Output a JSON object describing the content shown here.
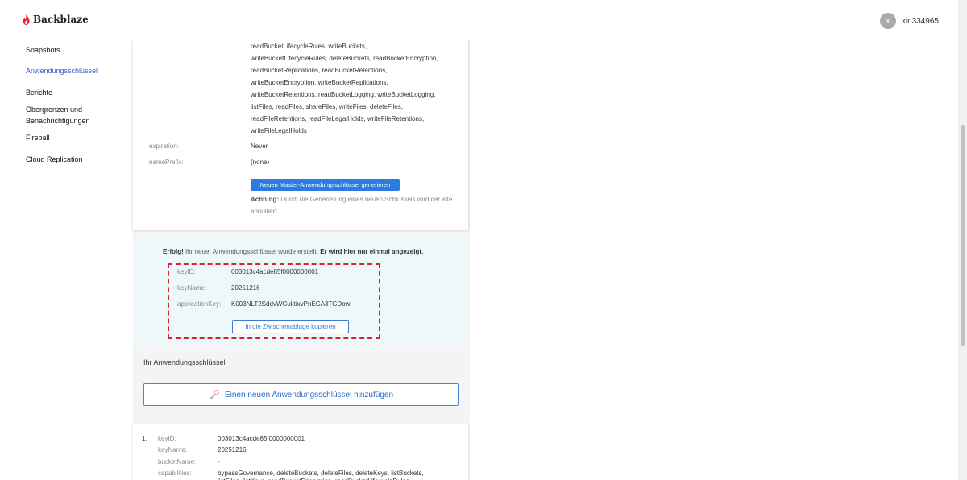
{
  "header": {
    "logo_text": "Backblaze",
    "avatar_initial": "x",
    "username": "xin334965"
  },
  "sidebar": {
    "items": [
      {
        "label": "Snapshots"
      },
      {
        "label": "Anwendungsschlüssel",
        "active": true
      },
      {
        "label": "Berichte"
      },
      {
        "label": "Obergrenzen und"
      },
      {
        "label": "Benachrichtigungen"
      },
      {
        "label": "Fireball"
      },
      {
        "label": "Cloud Replication"
      }
    ]
  },
  "master_key": {
    "capability_lines": [
      "readBucketLifecycleRules, writeBuckets,",
      "writeBucketLifecycleRules, deleteBuckets, readBucketEncryption,",
      "readBucketReplications, readBucketRetentions,",
      "writeBucketEncryption, writeBucketReplications,",
      "writeBucketRetentions, readBucketLogging, writeBucketLogging,",
      "listFiles, readFiles, shareFiles, writeFiles, deleteFiles,",
      "readFileRetentions, readFileLegalHolds, writeFileRetentions,",
      "writeFileLegalHolds"
    ],
    "expiration_label": "expiration:",
    "expiration_value": "Never",
    "nameprefix_label": "namePrefix:",
    "nameprefix_value": "(none)",
    "generate_button": "Neuen Master-Anwendungsschlüssel generieren",
    "warning_bold": "Achtung:",
    "warning_text": " Durch die Generierung eines neuen Schlüssels wird der alte annulliert."
  },
  "success": {
    "prefix_bold": "Erfolg!",
    "message": " Ihr neuer Anwendungsschlüssel wurde erstellt. ",
    "suffix_bold": "Er wird hier nur einmal angezeigt.",
    "keyid_label": "keyID:",
    "keyid_value": "003013c4acde85f0000000001",
    "keyname_label": "keyName:",
    "keyname_value": "20251216",
    "appkey_label": "applicationKey:",
    "appkey_value": "K003NLT2SddvWCuktixvPnECA3TGDow",
    "copy_button": "In die Zwischenablage kopieren"
  },
  "keys_section": {
    "title": "Ihr Anwendungsschlüssel",
    "add_button": "Einen neuen Anwendungsschlüssel hinzufügen"
  },
  "key_list": [
    {
      "index": "1.",
      "keyid_label": "keyID:",
      "keyid_value": "003013c4acde85f0000000001",
      "keyname_label": "keyName:",
      "keyname_value": "20251216",
      "bucketname_label": "bucketName:",
      "bucketname_value": "-",
      "capabilities_label": "capabilities:",
      "capabilities_line1": "bypassGovernance, deleteBuckets, deleteFiles, deleteKeys, listBuckets,",
      "capabilities_line2": "listFiles, listKeys, readBucketEncryption, readBucketLifecycleRules,"
    }
  ],
  "colors": {
    "accent": "#2c7be0",
    "success_bg": "#eef8fb",
    "highlight_border": "#d42626",
    "sidebar_active": "#3a5ec9"
  }
}
